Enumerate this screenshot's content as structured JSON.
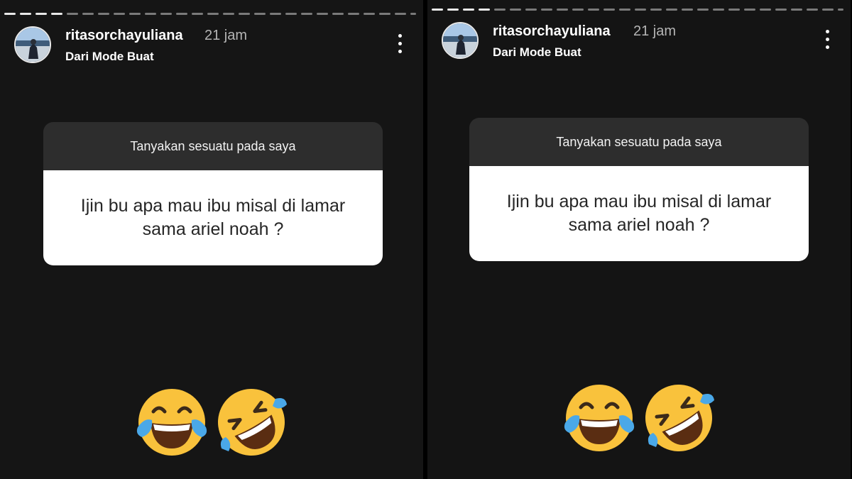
{
  "panels": [
    {
      "username": "ritasorchayuliana",
      "time": "21 jam",
      "subtitle": "Dari Mode Buat",
      "question_prompt": "Tanyakan sesuatu pada saya",
      "question_line1": "Ijin bu apa mau ibu misal di lamar",
      "question_line2": "sama ariel noah ?",
      "emojis": [
        "face-with-tears-of-joy-icon",
        "rolling-on-the-floor-laughing-icon"
      ]
    },
    {
      "username": "ritasorchayuliana",
      "time": "21 jam",
      "subtitle": "Dari Mode Buat",
      "question_prompt": "Tanyakan sesuatu pada saya",
      "question_line1": "Ijin bu apa mau ibu misal di lamar",
      "question_line2": "sama ariel noah ?",
      "emojis": [
        "face-with-tears-of-joy-icon",
        "rolling-on-the-floor-laughing-icon"
      ]
    }
  ],
  "colors": {
    "background": "#151515",
    "question_header": "#2d2d2d",
    "question_body": "#ffffff",
    "emoji_yellow": "#f9c23c"
  }
}
